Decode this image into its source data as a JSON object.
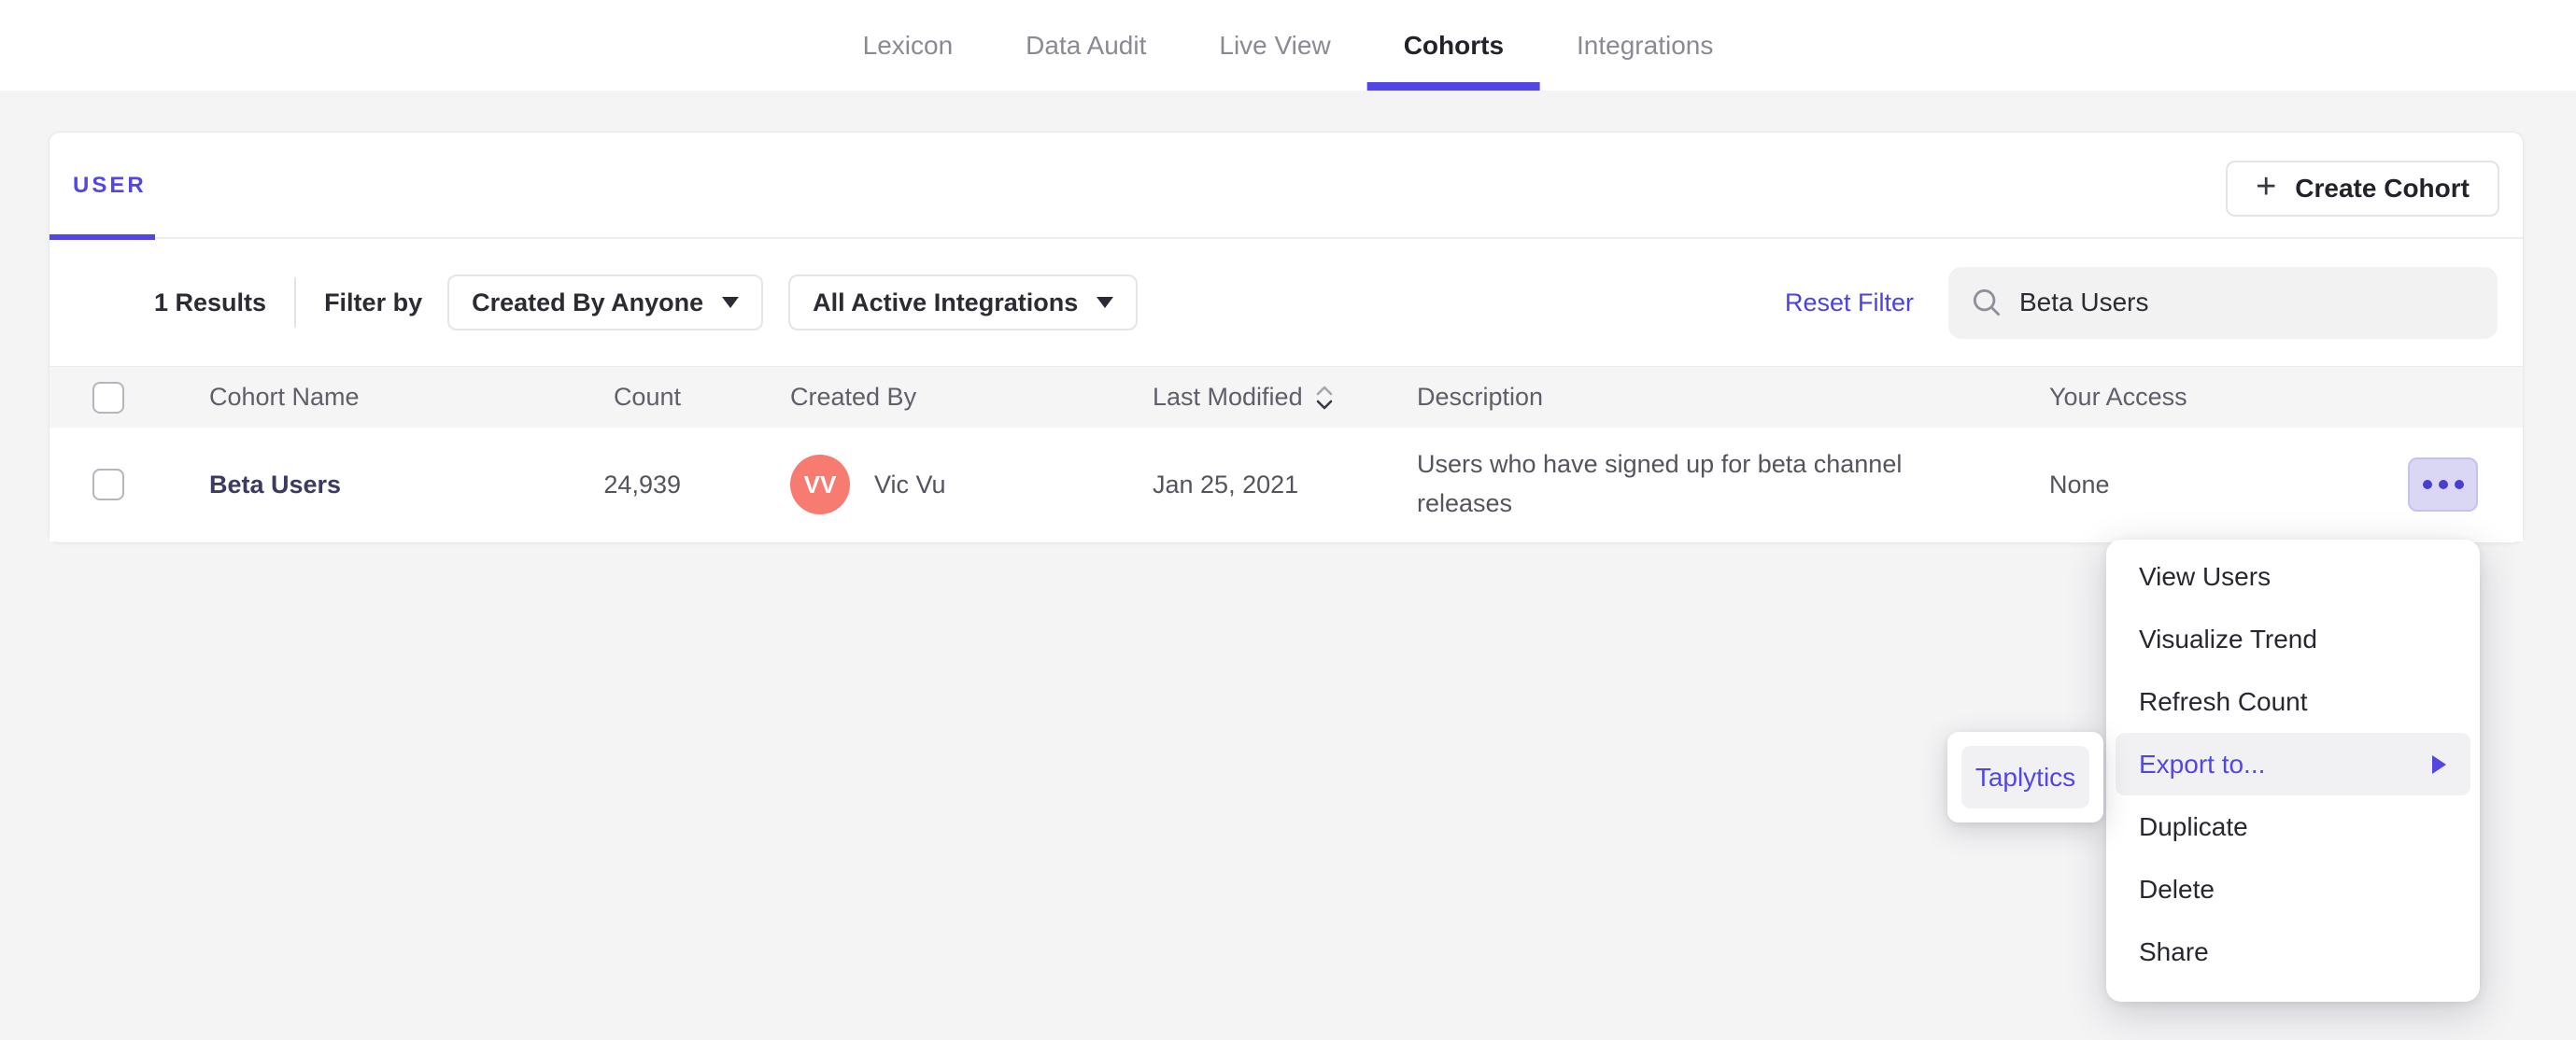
{
  "nav": {
    "items": [
      {
        "label": "Lexicon",
        "active": false
      },
      {
        "label": "Data Audit",
        "active": false
      },
      {
        "label": "Live View",
        "active": false
      },
      {
        "label": "Cohorts",
        "active": true
      },
      {
        "label": "Integrations",
        "active": false
      }
    ]
  },
  "card": {
    "tab_label": "USER",
    "create_button": {
      "plus": "+",
      "label": "Create Cohort"
    }
  },
  "filter_bar": {
    "results": "1 Results",
    "filter_by_label": "Filter by",
    "created_by_dropdown": "Created By Anyone",
    "integrations_dropdown": "All Active Integrations",
    "reset_label": "Reset Filter",
    "search_value": "Beta Users"
  },
  "table": {
    "columns": [
      "Cohort Name",
      "Count",
      "Created By",
      "Last Modified",
      "Description",
      "Your Access"
    ],
    "rows": [
      {
        "name": "Beta Users",
        "count": "24,939",
        "avatar_initials": "VV",
        "created_by": "Vic Vu",
        "last_modified": "Jan 25, 2021",
        "description": "Users who have signed up for beta channel releases",
        "access": "None"
      }
    ]
  },
  "menu": {
    "items": [
      "View Users",
      "Visualize Trend",
      "Refresh Count",
      "Export to...",
      "Duplicate",
      "Delete",
      "Share"
    ],
    "highlighted_item": "Export to...",
    "submenu_items": [
      "Taplytics"
    ]
  },
  "colors": {
    "accent_purple": "#5347e4",
    "link_blue": "#4b42e0",
    "row_name_indigo": "#3d3a62",
    "avatar_coral": "#f87b72",
    "dots_button_bg": "#dad7f5",
    "menu_highlight_bg": "#f1f0f2",
    "page_bg": "#f4f4f5",
    "header_band_bg": "#f5f5f6"
  }
}
